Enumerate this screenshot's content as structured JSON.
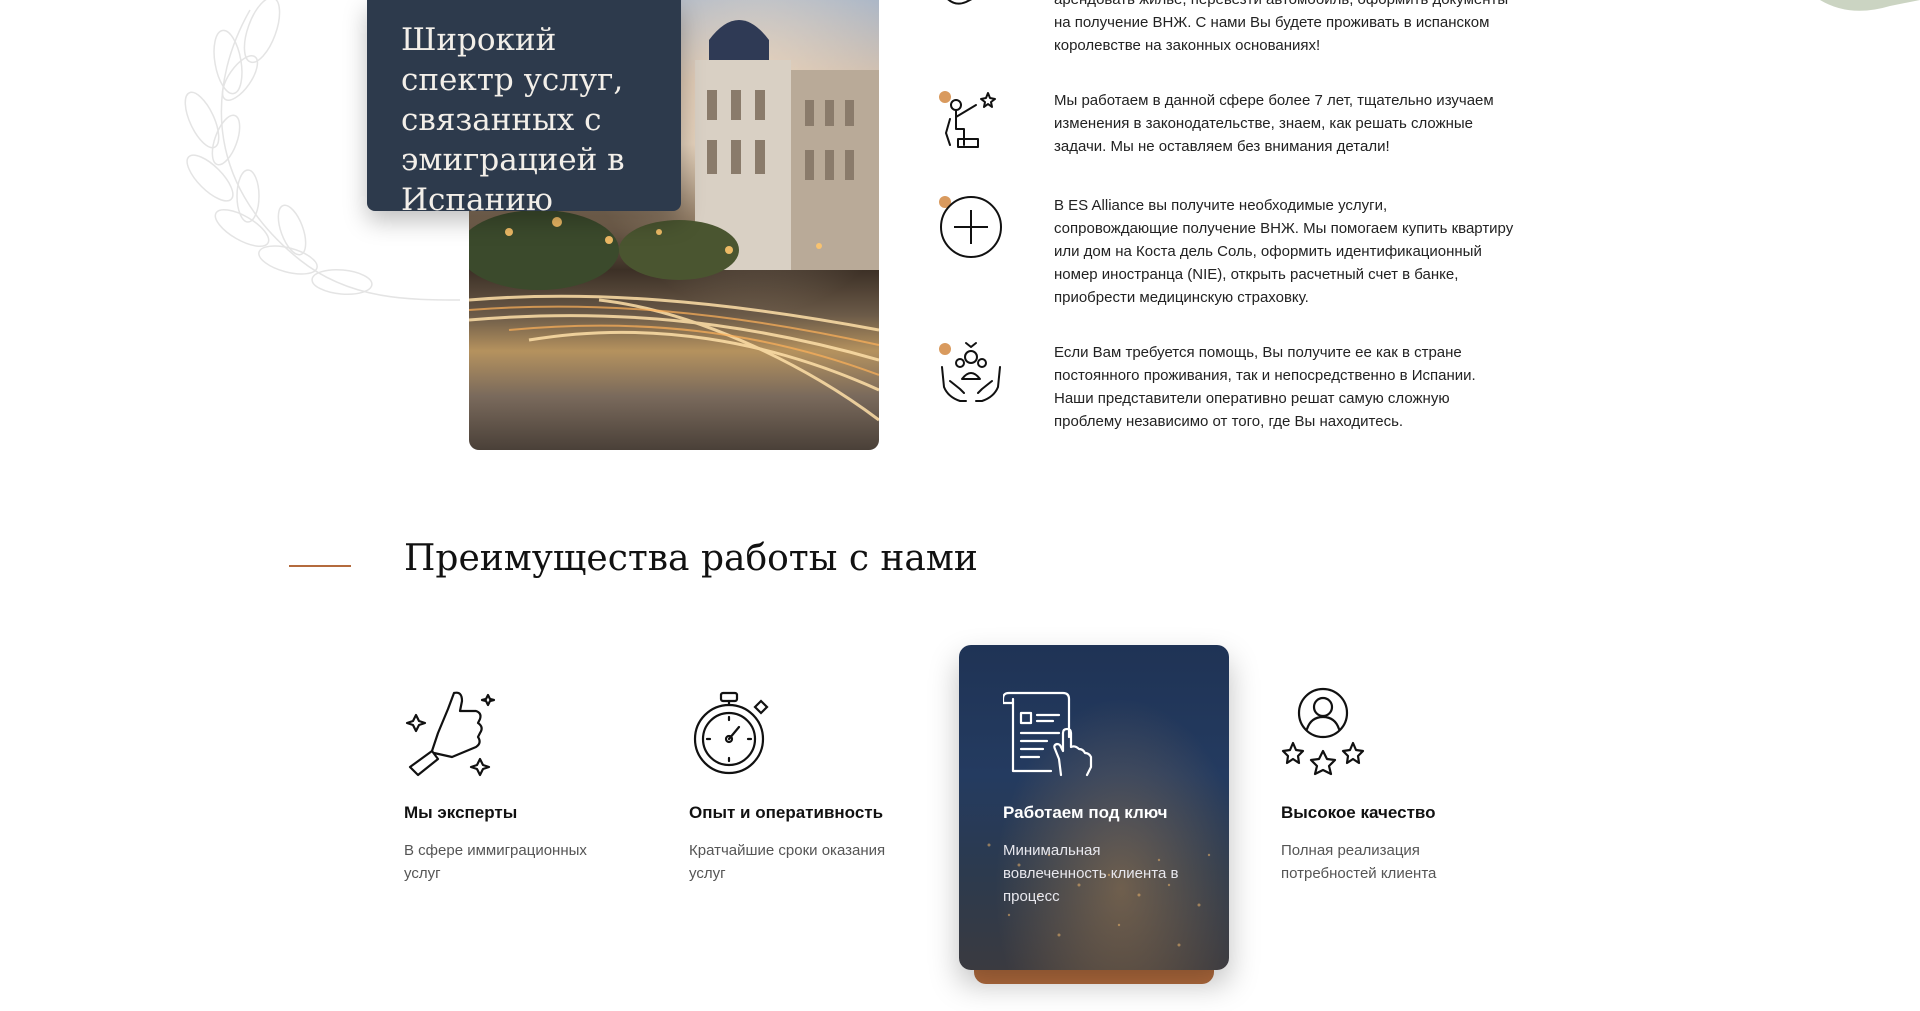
{
  "promo": {
    "title": "Широкий спектр услуг, связанных с эмиграцией в Испанию"
  },
  "services": [
    {
      "icon": "map-icon",
      "text": "арендовать жилье, перевезти автомобиль, оформить документы на получение ВНЖ. С нами Вы будете проживать в испанском королевстве на законных основаниях!"
    },
    {
      "icon": "achievement-icon",
      "text": "Мы работаем в данной сфере более 7 лет, тщательно изучаем изменения в законодательстве, знаем, как решать сложные задачи. Мы не оставляем без внимания детали!"
    },
    {
      "icon": "plus-circle-icon",
      "text": "В ES Alliance вы получите необходимые услуги, сопровождающие получение ВНЖ. Мы помогаем купить квартиру или дом на Коста дель Соль, оформить идентификационный номер иностранца (NIE), открыть расчетный счет в банке, приобрести медицинскую страховку."
    },
    {
      "icon": "care-hands-icon",
      "text": "Если Вам требуется помощь, Вы получите ее как в стране постоянного проживания, так и непосредственно в Испании. Наши представители оперативно решат самую сложную проблему независимо от того, где Вы находитесь."
    }
  ],
  "advantages": {
    "title": "Преимущества работы с нами",
    "items": [
      {
        "icon": "thumbs-up-icon",
        "title": "Мы эксперты",
        "desc": "В сфере иммиграционных услуг"
      },
      {
        "icon": "stopwatch-icon",
        "title": "Опыт и оперативность",
        "desc": "Кратчайшие сроки оказания услуг"
      },
      {
        "icon": "document-hand-icon",
        "title": "Работаем под ключ",
        "desc": "Минимальная вовлеченность клиента в процесс",
        "active": true
      },
      {
        "icon": "user-stars-icon",
        "title": "Высокое качество",
        "desc": "Полная реализация потребностей клиента"
      }
    ]
  },
  "colors": {
    "accent": "#b46b3d",
    "card_dark": "#2d3a4c",
    "dot": "#d99a5e"
  }
}
